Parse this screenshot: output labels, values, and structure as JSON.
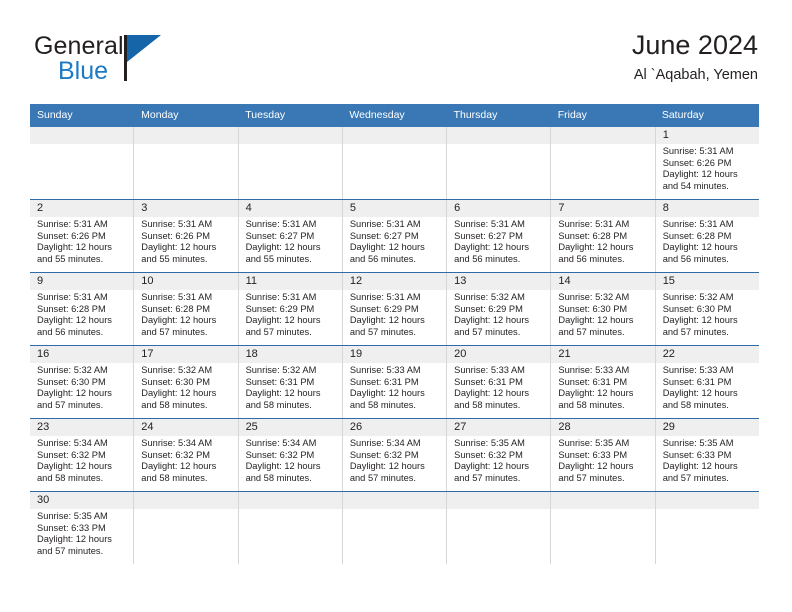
{
  "brand": {
    "word_one": "General",
    "word_two": "Blue",
    "flag_icon": "blue-flag-icon",
    "accent_color": "#1f7ac4"
  },
  "header": {
    "title": "June 2024",
    "subtitle": "Al `Aqabah, Yemen"
  },
  "theme": {
    "header_blue": "#3978b5",
    "row_divider_blue": "#2f6ca6",
    "daynum_band": "#efefef",
    "cell_border": "#d7d7d7",
    "text": "#231f20"
  },
  "calendar": {
    "weekday_headers": [
      "Sunday",
      "Monday",
      "Tuesday",
      "Wednesday",
      "Thursday",
      "Friday",
      "Saturday"
    ],
    "labels": {
      "sunrise": "Sunrise:",
      "sunset": "Sunset:",
      "daylight": "Daylight:"
    },
    "weeks": [
      [
        {
          "day": "",
          "empty": true,
          "sunrise": "",
          "sunset": "",
          "daylight_1": "",
          "daylight_2": ""
        },
        {
          "day": "",
          "empty": true,
          "sunrise": "",
          "sunset": "",
          "daylight_1": "",
          "daylight_2": ""
        },
        {
          "day": "",
          "empty": true,
          "sunrise": "",
          "sunset": "",
          "daylight_1": "",
          "daylight_2": ""
        },
        {
          "day": "",
          "empty": true,
          "sunrise": "",
          "sunset": "",
          "daylight_1": "",
          "daylight_2": ""
        },
        {
          "day": "",
          "empty": true,
          "sunrise": "",
          "sunset": "",
          "daylight_1": "",
          "daylight_2": ""
        },
        {
          "day": "",
          "empty": true,
          "sunrise": "",
          "sunset": "",
          "daylight_1": "",
          "daylight_2": ""
        },
        {
          "day": "1",
          "empty": false,
          "sunrise": "Sunrise: 5:31 AM",
          "sunset": "Sunset: 6:26 PM",
          "daylight_1": "Daylight: 12 hours",
          "daylight_2": "and 54 minutes."
        }
      ],
      [
        {
          "day": "2",
          "empty": false,
          "sunrise": "Sunrise: 5:31 AM",
          "sunset": "Sunset: 6:26 PM",
          "daylight_1": "Daylight: 12 hours",
          "daylight_2": "and 55 minutes."
        },
        {
          "day": "3",
          "empty": false,
          "sunrise": "Sunrise: 5:31 AM",
          "sunset": "Sunset: 6:26 PM",
          "daylight_1": "Daylight: 12 hours",
          "daylight_2": "and 55 minutes."
        },
        {
          "day": "4",
          "empty": false,
          "sunrise": "Sunrise: 5:31 AM",
          "sunset": "Sunset: 6:27 PM",
          "daylight_1": "Daylight: 12 hours",
          "daylight_2": "and 55 minutes."
        },
        {
          "day": "5",
          "empty": false,
          "sunrise": "Sunrise: 5:31 AM",
          "sunset": "Sunset: 6:27 PM",
          "daylight_1": "Daylight: 12 hours",
          "daylight_2": "and 56 minutes."
        },
        {
          "day": "6",
          "empty": false,
          "sunrise": "Sunrise: 5:31 AM",
          "sunset": "Sunset: 6:27 PM",
          "daylight_1": "Daylight: 12 hours",
          "daylight_2": "and 56 minutes."
        },
        {
          "day": "7",
          "empty": false,
          "sunrise": "Sunrise: 5:31 AM",
          "sunset": "Sunset: 6:28 PM",
          "daylight_1": "Daylight: 12 hours",
          "daylight_2": "and 56 minutes."
        },
        {
          "day": "8",
          "empty": false,
          "sunrise": "Sunrise: 5:31 AM",
          "sunset": "Sunset: 6:28 PM",
          "daylight_1": "Daylight: 12 hours",
          "daylight_2": "and 56 minutes."
        }
      ],
      [
        {
          "day": "9",
          "empty": false,
          "sunrise": "Sunrise: 5:31 AM",
          "sunset": "Sunset: 6:28 PM",
          "daylight_1": "Daylight: 12 hours",
          "daylight_2": "and 56 minutes."
        },
        {
          "day": "10",
          "empty": false,
          "sunrise": "Sunrise: 5:31 AM",
          "sunset": "Sunset: 6:28 PM",
          "daylight_1": "Daylight: 12 hours",
          "daylight_2": "and 57 minutes."
        },
        {
          "day": "11",
          "empty": false,
          "sunrise": "Sunrise: 5:31 AM",
          "sunset": "Sunset: 6:29 PM",
          "daylight_1": "Daylight: 12 hours",
          "daylight_2": "and 57 minutes."
        },
        {
          "day": "12",
          "empty": false,
          "sunrise": "Sunrise: 5:31 AM",
          "sunset": "Sunset: 6:29 PM",
          "daylight_1": "Daylight: 12 hours",
          "daylight_2": "and 57 minutes."
        },
        {
          "day": "13",
          "empty": false,
          "sunrise": "Sunrise: 5:32 AM",
          "sunset": "Sunset: 6:29 PM",
          "daylight_1": "Daylight: 12 hours",
          "daylight_2": "and 57 minutes."
        },
        {
          "day": "14",
          "empty": false,
          "sunrise": "Sunrise: 5:32 AM",
          "sunset": "Sunset: 6:30 PM",
          "daylight_1": "Daylight: 12 hours",
          "daylight_2": "and 57 minutes."
        },
        {
          "day": "15",
          "empty": false,
          "sunrise": "Sunrise: 5:32 AM",
          "sunset": "Sunset: 6:30 PM",
          "daylight_1": "Daylight: 12 hours",
          "daylight_2": "and 57 minutes."
        }
      ],
      [
        {
          "day": "16",
          "empty": false,
          "sunrise": "Sunrise: 5:32 AM",
          "sunset": "Sunset: 6:30 PM",
          "daylight_1": "Daylight: 12 hours",
          "daylight_2": "and 57 minutes."
        },
        {
          "day": "17",
          "empty": false,
          "sunrise": "Sunrise: 5:32 AM",
          "sunset": "Sunset: 6:30 PM",
          "daylight_1": "Daylight: 12 hours",
          "daylight_2": "and 58 minutes."
        },
        {
          "day": "18",
          "empty": false,
          "sunrise": "Sunrise: 5:32 AM",
          "sunset": "Sunset: 6:31 PM",
          "daylight_1": "Daylight: 12 hours",
          "daylight_2": "and 58 minutes."
        },
        {
          "day": "19",
          "empty": false,
          "sunrise": "Sunrise: 5:33 AM",
          "sunset": "Sunset: 6:31 PM",
          "daylight_1": "Daylight: 12 hours",
          "daylight_2": "and 58 minutes."
        },
        {
          "day": "20",
          "empty": false,
          "sunrise": "Sunrise: 5:33 AM",
          "sunset": "Sunset: 6:31 PM",
          "daylight_1": "Daylight: 12 hours",
          "daylight_2": "and 58 minutes."
        },
        {
          "day": "21",
          "empty": false,
          "sunrise": "Sunrise: 5:33 AM",
          "sunset": "Sunset: 6:31 PM",
          "daylight_1": "Daylight: 12 hours",
          "daylight_2": "and 58 minutes."
        },
        {
          "day": "22",
          "empty": false,
          "sunrise": "Sunrise: 5:33 AM",
          "sunset": "Sunset: 6:31 PM",
          "daylight_1": "Daylight: 12 hours",
          "daylight_2": "and 58 minutes."
        }
      ],
      [
        {
          "day": "23",
          "empty": false,
          "sunrise": "Sunrise: 5:34 AM",
          "sunset": "Sunset: 6:32 PM",
          "daylight_1": "Daylight: 12 hours",
          "daylight_2": "and 58 minutes."
        },
        {
          "day": "24",
          "empty": false,
          "sunrise": "Sunrise: 5:34 AM",
          "sunset": "Sunset: 6:32 PM",
          "daylight_1": "Daylight: 12 hours",
          "daylight_2": "and 58 minutes."
        },
        {
          "day": "25",
          "empty": false,
          "sunrise": "Sunrise: 5:34 AM",
          "sunset": "Sunset: 6:32 PM",
          "daylight_1": "Daylight: 12 hours",
          "daylight_2": "and 58 minutes."
        },
        {
          "day": "26",
          "empty": false,
          "sunrise": "Sunrise: 5:34 AM",
          "sunset": "Sunset: 6:32 PM",
          "daylight_1": "Daylight: 12 hours",
          "daylight_2": "and 57 minutes."
        },
        {
          "day": "27",
          "empty": false,
          "sunrise": "Sunrise: 5:35 AM",
          "sunset": "Sunset: 6:32 PM",
          "daylight_1": "Daylight: 12 hours",
          "daylight_2": "and 57 minutes."
        },
        {
          "day": "28",
          "empty": false,
          "sunrise": "Sunrise: 5:35 AM",
          "sunset": "Sunset: 6:33 PM",
          "daylight_1": "Daylight: 12 hours",
          "daylight_2": "and 57 minutes."
        },
        {
          "day": "29",
          "empty": false,
          "sunrise": "Sunrise: 5:35 AM",
          "sunset": "Sunset: 6:33 PM",
          "daylight_1": "Daylight: 12 hours",
          "daylight_2": "and 57 minutes."
        }
      ],
      [
        {
          "day": "30",
          "empty": false,
          "sunrise": "Sunrise: 5:35 AM",
          "sunset": "Sunset: 6:33 PM",
          "daylight_1": "Daylight: 12 hours",
          "daylight_2": "and 57 minutes."
        },
        {
          "day": "",
          "empty": true,
          "sunrise": "",
          "sunset": "",
          "daylight_1": "",
          "daylight_2": ""
        },
        {
          "day": "",
          "empty": true,
          "sunrise": "",
          "sunset": "",
          "daylight_1": "",
          "daylight_2": ""
        },
        {
          "day": "",
          "empty": true,
          "sunrise": "",
          "sunset": "",
          "daylight_1": "",
          "daylight_2": ""
        },
        {
          "day": "",
          "empty": true,
          "sunrise": "",
          "sunset": "",
          "daylight_1": "",
          "daylight_2": ""
        },
        {
          "day": "",
          "empty": true,
          "sunrise": "",
          "sunset": "",
          "daylight_1": "",
          "daylight_2": ""
        },
        {
          "day": "",
          "empty": true,
          "sunrise": "",
          "sunset": "",
          "daylight_1": "",
          "daylight_2": ""
        }
      ]
    ]
  }
}
